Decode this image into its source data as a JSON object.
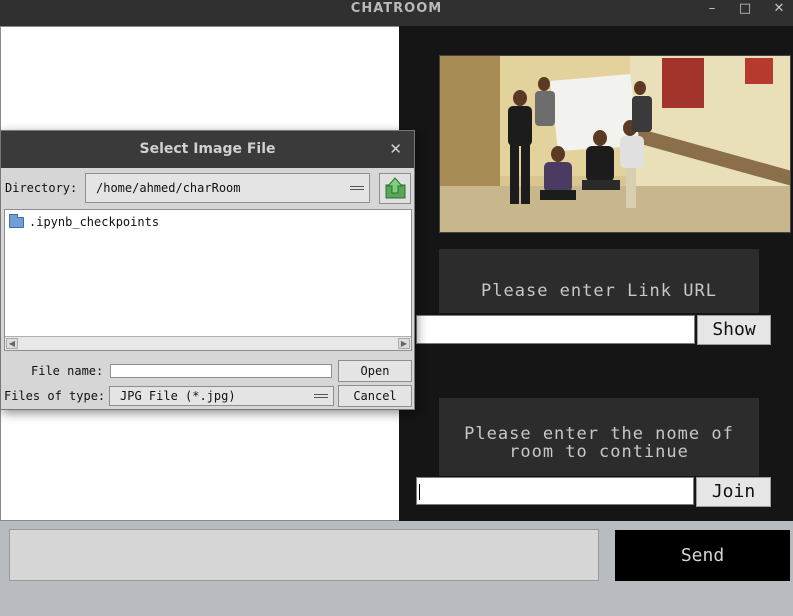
{
  "window": {
    "title": "CHATROOM",
    "controls": {
      "minimize": "–",
      "maximize": "□",
      "close": "✕"
    }
  },
  "right_panel": {
    "link_prompt": "Please enter Link URL",
    "link_value": "",
    "show_label": "Show",
    "room_prompt_line1": "Please enter the nome of",
    "room_prompt_line2": "room to continue",
    "room_value": "",
    "join_label": "Join"
  },
  "bottom": {
    "message_value": "",
    "send_label": "Send"
  },
  "dialog": {
    "title": "Select Image File",
    "close": "✕",
    "directory_label": "Directory:",
    "directory_value": "/home/ahmed/charRoom",
    "files": [
      ".ipynb_checkpoints"
    ],
    "file_name_label": "File name:",
    "file_name_value": "",
    "files_of_type_label": "Files of type:",
    "files_of_type_value": "JPG File (*.jpg)",
    "open_label": "Open",
    "cancel_label": "Cancel"
  },
  "colors": {
    "titlebar": "#303030",
    "panel_dark": "#151515",
    "prompt_box": "#2c2c2c",
    "send_button": "#000000",
    "folder_icon": "#6f9fd3"
  }
}
